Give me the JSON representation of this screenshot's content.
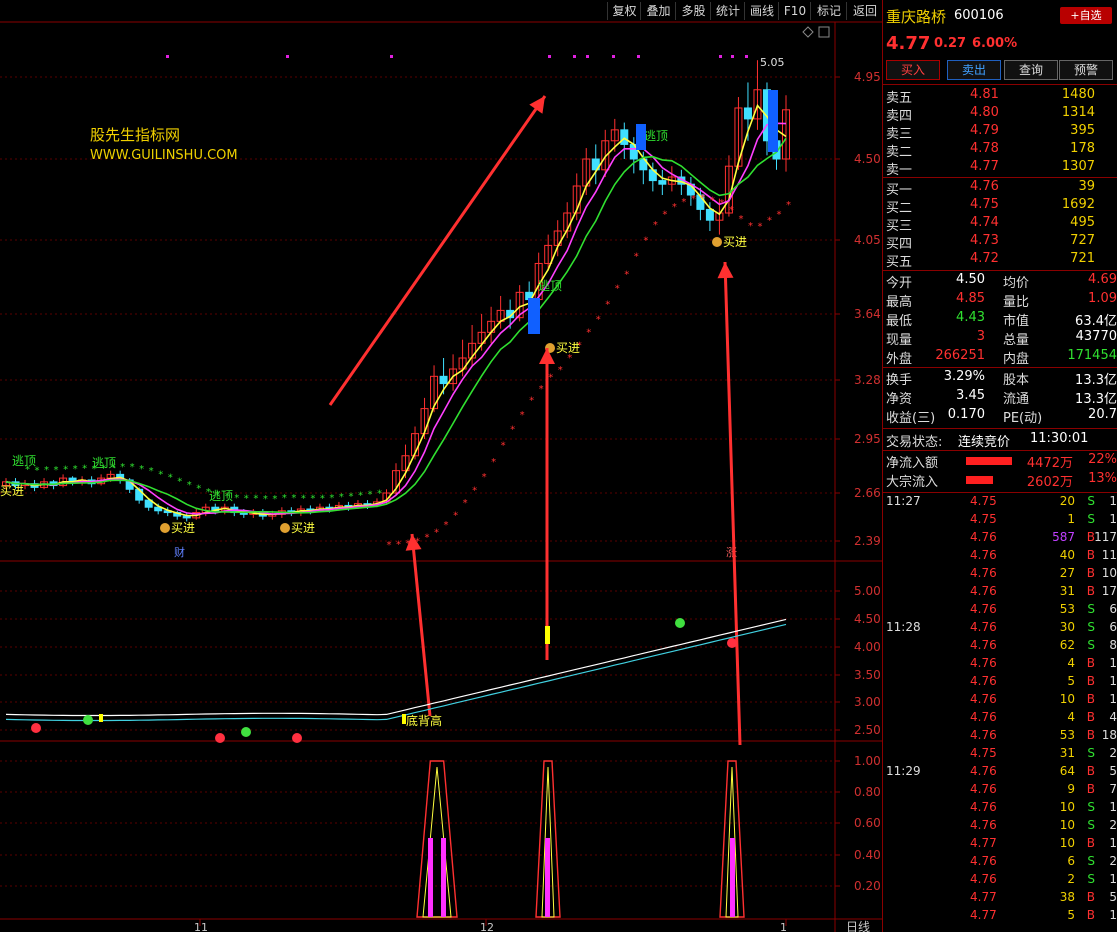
{
  "toolbar": [
    "复权",
    "叠加",
    "多股",
    "统计",
    "画线",
    "F10",
    "标记",
    "返回"
  ],
  "watermark": {
    "line1": "股先生指标网",
    "line2": "WWW.GUILINSHU.COM"
  },
  "price_axis": [
    "4.95",
    "4.50",
    "4.05",
    "3.64",
    "3.28",
    "2.95",
    "2.66",
    "2.39"
  ],
  "ind_axis": [
    "5.00",
    "4.50",
    "4.00",
    "3.50",
    "3.00",
    "2.50"
  ],
  "sub_axis": [
    "1.00",
    "0.80",
    "0.60",
    "0.40",
    "0.20"
  ],
  "date_labels": [
    "11",
    "12",
    "1"
  ],
  "period_label": "日线",
  "chart_labels": {
    "escape": "逃顶",
    "buy": "买进",
    "high_mark": "5.05",
    "cai": "财",
    "ind_mark": "底背高",
    "chart_tag": "涨"
  },
  "stock": {
    "name": "重庆路桥",
    "code": "600106",
    "add_label": "+自选",
    "price": "4.77",
    "change": "0.27",
    "pct": "6.00%"
  },
  "trade_buttons": [
    "买入",
    "卖出",
    "查询",
    "预警"
  ],
  "asks": [
    {
      "label": "卖五",
      "price": "4.81",
      "vol": "1480"
    },
    {
      "label": "卖四",
      "price": "4.80",
      "vol": "1314"
    },
    {
      "label": "卖三",
      "price": "4.79",
      "vol": "395"
    },
    {
      "label": "卖二",
      "price": "4.78",
      "vol": "178"
    },
    {
      "label": "卖一",
      "price": "4.77",
      "vol": "1307"
    }
  ],
  "bids": [
    {
      "label": "买一",
      "price": "4.76",
      "vol": "39"
    },
    {
      "label": "买二",
      "price": "4.75",
      "vol": "1692"
    },
    {
      "label": "买三",
      "price": "4.74",
      "vol": "495"
    },
    {
      "label": "买四",
      "price": "4.73",
      "vol": "727"
    },
    {
      "label": "买五",
      "price": "4.72",
      "vol": "721"
    }
  ],
  "stats1": [
    {
      "l1": "今开",
      "v1": "4.50",
      "c1": "#ffffff",
      "l2": "均价",
      "v2": "4.69",
      "c2": "#ff3030"
    },
    {
      "l1": "最高",
      "v1": "4.85",
      "c1": "#ff3030",
      "l2": "量比",
      "v2": "1.09",
      "c2": "#ff3030"
    },
    {
      "l1": "最低",
      "v1": "4.43",
      "c1": "#30e030",
      "l2": "市值",
      "v2": "63.4亿",
      "c2": "#ffffff"
    },
    {
      "l1": "现量",
      "v1": "3",
      "c1": "#ff3030",
      "l2": "总量",
      "v2": "43770",
      "c2": "#ffffff"
    },
    {
      "l1": "外盘",
      "v1": "266251",
      "c1": "#ff3030",
      "l2": "内盘",
      "v2": "171454",
      "c2": "#30e030"
    }
  ],
  "stats2": [
    {
      "l1": "换手",
      "v1": "3.29%",
      "l2": "股本",
      "v2": "13.3亿"
    },
    {
      "l1": "净资",
      "v1": "3.45",
      "l2": "流通",
      "v2": "13.3亿"
    },
    {
      "l1": "收益(三)",
      "v1": "0.170",
      "l2": "PE(动)",
      "v2": "20.7"
    }
  ],
  "trade_status": {
    "label": "交易状态:",
    "value": "连续竞价",
    "time": "11:30:01"
  },
  "flows": [
    {
      "label": "净流入额",
      "value": "4472万",
      "pct": "22%",
      "bar": 0.22
    },
    {
      "label": "大宗流入",
      "value": "2602万",
      "pct": "13%",
      "bar": 0.13
    }
  ],
  "ticks": [
    {
      "t": "11:27",
      "p": "4.75",
      "v": "20",
      "s": "S",
      "n": "1"
    },
    {
      "t": "",
      "p": "4.75",
      "v": "1",
      "s": "S",
      "n": "1"
    },
    {
      "t": "",
      "p": "4.76",
      "v": "587",
      "s": "B",
      "n": "117"
    },
    {
      "t": "",
      "p": "4.76",
      "v": "40",
      "s": "B",
      "n": "11"
    },
    {
      "t": "",
      "p": "4.76",
      "v": "27",
      "s": "B",
      "n": "10"
    },
    {
      "t": "",
      "p": "4.76",
      "v": "31",
      "s": "B",
      "n": "17"
    },
    {
      "t": "",
      "p": "4.76",
      "v": "53",
      "s": "S",
      "n": "6"
    },
    {
      "t": "11:28",
      "p": "4.76",
      "v": "30",
      "s": "S",
      "n": "6"
    },
    {
      "t": "",
      "p": "4.76",
      "v": "62",
      "s": "S",
      "n": "8"
    },
    {
      "t": "",
      "p": "4.76",
      "v": "4",
      "s": "B",
      "n": "1"
    },
    {
      "t": "",
      "p": "4.76",
      "v": "5",
      "s": "B",
      "n": "1"
    },
    {
      "t": "",
      "p": "4.76",
      "v": "10",
      "s": "B",
      "n": "1"
    },
    {
      "t": "",
      "p": "4.76",
      "v": "4",
      "s": "B",
      "n": "4"
    },
    {
      "t": "",
      "p": "4.76",
      "v": "53",
      "s": "B",
      "n": "18"
    },
    {
      "t": "",
      "p": "4.75",
      "v": "31",
      "s": "S",
      "n": "2"
    },
    {
      "t": "11:29",
      "p": "4.76",
      "v": "64",
      "s": "B",
      "n": "5"
    },
    {
      "t": "",
      "p": "4.76",
      "v": "9",
      "s": "B",
      "n": "7"
    },
    {
      "t": "",
      "p": "4.76",
      "v": "10",
      "s": "S",
      "n": "1"
    },
    {
      "t": "",
      "p": "4.76",
      "v": "10",
      "s": "S",
      "n": "2"
    },
    {
      "t": "",
      "p": "4.77",
      "v": "10",
      "s": "B",
      "n": "1"
    },
    {
      "t": "",
      "p": "4.76",
      "v": "6",
      "s": "S",
      "n": "2"
    },
    {
      "t": "",
      "p": "4.76",
      "v": "2",
      "s": "S",
      "n": "1"
    },
    {
      "t": "",
      "p": "4.77",
      "v": "38",
      "s": "B",
      "n": "5"
    },
    {
      "t": "",
      "p": "4.77",
      "v": "5",
      "s": "B",
      "n": "1"
    }
  ],
  "chart_data": {
    "type": "candlestick",
    "ylim": [
      2.2,
      5.2
    ],
    "candles": [
      [
        2.7,
        2.72,
        2.68,
        2.74
      ],
      [
        2.72,
        2.7,
        2.68,
        2.74
      ],
      [
        2.7,
        2.71,
        2.68,
        2.73
      ],
      [
        2.71,
        2.69,
        2.67,
        2.73
      ],
      [
        2.69,
        2.72,
        2.68,
        2.74
      ],
      [
        2.72,
        2.7,
        2.68,
        2.73
      ],
      [
        2.7,
        2.74,
        2.69,
        2.76
      ],
      [
        2.74,
        2.72,
        2.7,
        2.75
      ],
      [
        2.72,
        2.73,
        2.7,
        2.75
      ],
      [
        2.73,
        2.71,
        2.69,
        2.75
      ],
      [
        2.71,
        2.74,
        2.7,
        2.76
      ],
      [
        2.74,
        2.76,
        2.72,
        2.78
      ],
      [
        2.76,
        2.73,
        2.71,
        2.78
      ],
      [
        2.73,
        2.68,
        2.66,
        2.74
      ],
      [
        2.68,
        2.62,
        2.6,
        2.69
      ],
      [
        2.62,
        2.58,
        2.56,
        2.63
      ],
      [
        2.58,
        2.56,
        2.54,
        2.6
      ],
      [
        2.56,
        2.55,
        2.53,
        2.58
      ],
      [
        2.55,
        2.53,
        2.51,
        2.56
      ],
      [
        2.53,
        2.52,
        2.5,
        2.55
      ],
      [
        2.52,
        2.55,
        2.51,
        2.57
      ],
      [
        2.55,
        2.58,
        2.53,
        2.6
      ],
      [
        2.58,
        2.56,
        2.54,
        2.6
      ],
      [
        2.56,
        2.58,
        2.54,
        2.6
      ],
      [
        2.58,
        2.55,
        2.53,
        2.6
      ],
      [
        2.55,
        2.54,
        2.52,
        2.57
      ],
      [
        2.54,
        2.55,
        2.52,
        2.57
      ],
      [
        2.55,
        2.53,
        2.51,
        2.57
      ],
      [
        2.53,
        2.54,
        2.51,
        2.56
      ],
      [
        2.54,
        2.56,
        2.52,
        2.58
      ],
      [
        2.56,
        2.55,
        2.53,
        2.58
      ],
      [
        2.55,
        2.57,
        2.53,
        2.59
      ],
      [
        2.57,
        2.56,
        2.54,
        2.59
      ],
      [
        2.56,
        2.58,
        2.55,
        2.6
      ],
      [
        2.58,
        2.57,
        2.55,
        2.6
      ],
      [
        2.57,
        2.59,
        2.56,
        2.61
      ],
      [
        2.59,
        2.58,
        2.56,
        2.61
      ],
      [
        2.58,
        2.6,
        2.57,
        2.62
      ],
      [
        2.6,
        2.59,
        2.57,
        2.62
      ],
      [
        2.59,
        2.61,
        2.58,
        2.63
      ],
      [
        2.61,
        2.66,
        2.6,
        2.68
      ],
      [
        2.66,
        2.78,
        2.65,
        2.82
      ],
      [
        2.78,
        2.86,
        2.74,
        2.92
      ],
      [
        2.86,
        2.98,
        2.84,
        3.02
      ],
      [
        2.98,
        3.12,
        2.95,
        3.18
      ],
      [
        3.12,
        3.3,
        3.1,
        3.36
      ],
      [
        3.3,
        3.26,
        3.2,
        3.4
      ],
      [
        3.26,
        3.34,
        3.22,
        3.42
      ],
      [
        3.34,
        3.4,
        3.3,
        3.5
      ],
      [
        3.4,
        3.48,
        3.36,
        3.58
      ],
      [
        3.48,
        3.54,
        3.44,
        3.64
      ],
      [
        3.54,
        3.6,
        3.48,
        3.68
      ],
      [
        3.6,
        3.66,
        3.56,
        3.74
      ],
      [
        3.66,
        3.62,
        3.56,
        3.72
      ],
      [
        3.62,
        3.76,
        3.6,
        3.8
      ],
      [
        3.76,
        3.72,
        3.62,
        3.82
      ],
      [
        3.72,
        3.92,
        3.7,
        3.98
      ],
      [
        3.92,
        4.02,
        3.88,
        4.08
      ],
      [
        4.02,
        4.1,
        3.96,
        4.16
      ],
      [
        4.1,
        4.2,
        4.06,
        4.26
      ],
      [
        4.2,
        4.35,
        4.16,
        4.42
      ],
      [
        4.35,
        4.5,
        4.3,
        4.56
      ],
      [
        4.5,
        4.44,
        4.36,
        4.58
      ],
      [
        4.44,
        4.6,
        4.4,
        4.66
      ],
      [
        4.6,
        4.66,
        4.54,
        4.72
      ],
      [
        4.66,
        4.58,
        4.5,
        4.7
      ],
      [
        4.58,
        4.5,
        4.42,
        4.62
      ],
      [
        4.5,
        4.44,
        4.36,
        4.54
      ],
      [
        4.44,
        4.38,
        4.32,
        4.48
      ],
      [
        4.38,
        4.36,
        4.3,
        4.44
      ],
      [
        4.36,
        4.4,
        4.32,
        4.46
      ],
      [
        4.4,
        4.36,
        4.3,
        4.44
      ],
      [
        4.36,
        4.3,
        4.24,
        4.4
      ],
      [
        4.3,
        4.22,
        4.16,
        4.34
      ],
      [
        4.22,
        4.16,
        4.1,
        4.26
      ],
      [
        4.16,
        4.2,
        4.08,
        4.28
      ],
      [
        4.2,
        4.46,
        4.18,
        4.52
      ],
      [
        4.46,
        4.78,
        4.44,
        4.84
      ],
      [
        4.78,
        4.72,
        4.6,
        4.92
      ],
      [
        4.72,
        4.88,
        4.66,
        5.05
      ],
      [
        4.88,
        4.6,
        4.52,
        4.92
      ],
      [
        4.6,
        4.5,
        4.44,
        4.7
      ],
      [
        4.5,
        4.77,
        4.43,
        4.85
      ]
    ]
  }
}
